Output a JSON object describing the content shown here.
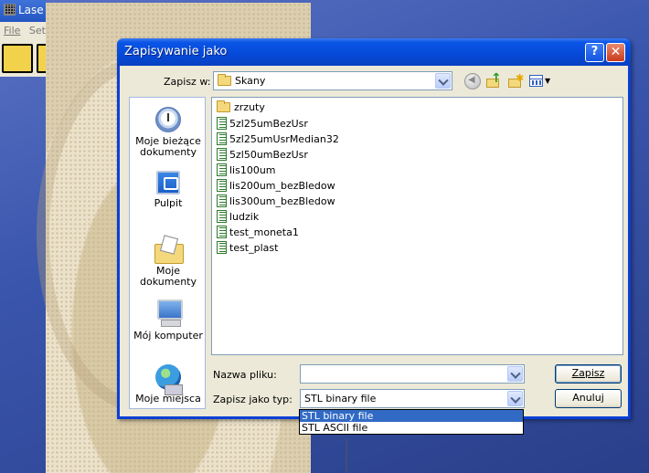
{
  "background_app": {
    "title": "Lase",
    "menu": [
      "File",
      "Set"
    ]
  },
  "dialog": {
    "title": "Zapisywanie jako",
    "help_glyph": "?",
    "close_glyph": "✕",
    "save_in_label": "Zapisz w:",
    "save_in_value": "Skany",
    "places": [
      {
        "label": "Moje bieżące dokumenty",
        "icon": "recent-documents-icon"
      },
      {
        "label": "Pulpit",
        "icon": "desktop-icon"
      },
      {
        "label": "Moje dokumenty",
        "icon": "my-documents-icon"
      },
      {
        "label": "Mój komputer",
        "icon": "my-computer-icon"
      },
      {
        "label": "Moje miejsca",
        "icon": "network-places-icon"
      }
    ],
    "files": [
      {
        "name": "zrzuty",
        "type": "folder"
      },
      {
        "name": "5zl25umBezUsr",
        "type": "file"
      },
      {
        "name": "5zl25umUsrMedian32",
        "type": "file"
      },
      {
        "name": "5zl50umBezUsr",
        "type": "file"
      },
      {
        "name": "lis100um",
        "type": "file"
      },
      {
        "name": "lis200um_bezBledow",
        "type": "file"
      },
      {
        "name": "lis300um_bezBledow",
        "type": "file"
      },
      {
        "name": "ludzik",
        "type": "file"
      },
      {
        "name": "test_moneta1",
        "type": "file"
      },
      {
        "name": "test_plast",
        "type": "file"
      }
    ],
    "filename_label": "Nazwa pliku:",
    "filename_value": "",
    "filetype_label": "Zapisz jako typ:",
    "filetype_value": "STL binary file",
    "filetype_options": [
      "STL binary file",
      "STL ASCII file"
    ],
    "save_button": "Zapisz",
    "cancel_button": "Anuluj"
  }
}
